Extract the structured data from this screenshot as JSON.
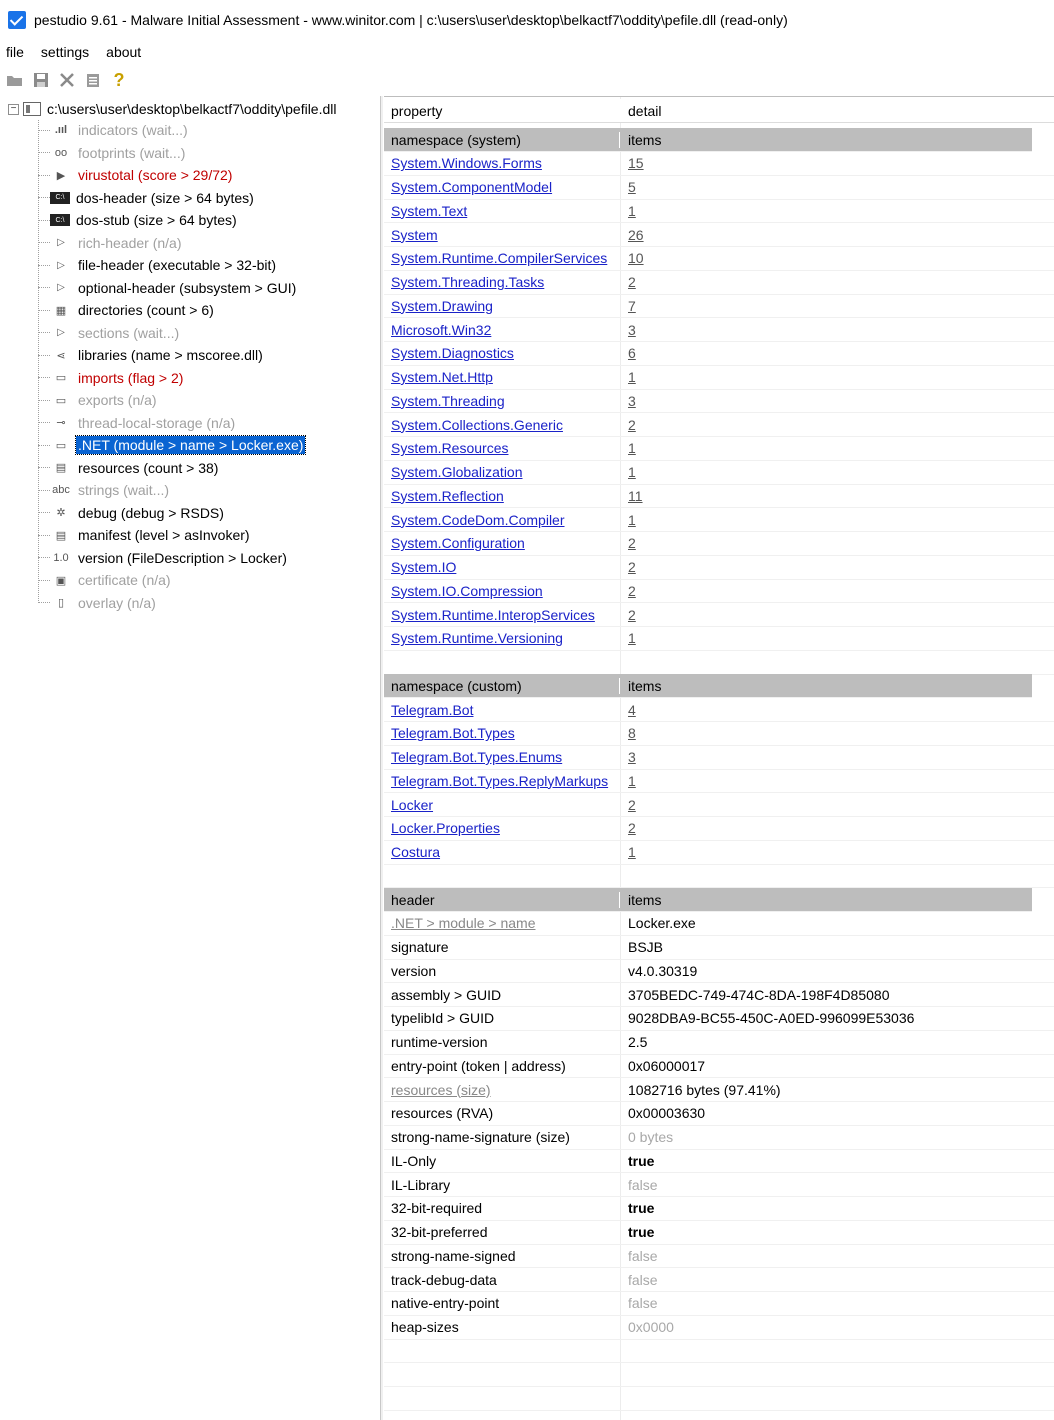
{
  "window": {
    "title": "pestudio 9.61 - Malware Initial Assessment - www.winitor.com | c:\\users\\user\\desktop\\belkactf7\\oddity\\pefile.dll (read-only)"
  },
  "menu": [
    "file",
    "settings",
    "about"
  ],
  "toolbar": {
    "icons": [
      "open-icon",
      "save-icon",
      "close-icon",
      "copy-icon",
      "help-icon"
    ],
    "help_glyph": "?"
  },
  "tree": {
    "root": "c:\\users\\user\\desktop\\belkactf7\\oddity\\pefile.dll",
    "root_expander": "−",
    "nodes": [
      {
        "label": "indicators (wait...)",
        "state": "grey",
        "icon": "indicators-icon",
        "glyph": ".ııl"
      },
      {
        "label": "footprints (wait...)",
        "state": "grey",
        "icon": "footprints-icon",
        "glyph": "oo"
      },
      {
        "label": "virustotal (score > 29/72)",
        "state": "red",
        "icon": "virustotal-icon",
        "glyph": "▶"
      },
      {
        "label": "dos-header (size > 64 bytes)",
        "state": "normal",
        "icon": "dos-header-icon",
        "glyph": "C:\\"
      },
      {
        "label": "dos-stub (size > 64 bytes)",
        "state": "normal",
        "icon": "dos-stub-icon",
        "glyph": "C:\\"
      },
      {
        "label": "rich-header (n/a)",
        "state": "grey",
        "icon": "rich-header-icon",
        "glyph": "▷"
      },
      {
        "label": "file-header (executable > 32-bit)",
        "state": "normal",
        "icon": "file-header-icon",
        "glyph": "▷"
      },
      {
        "label": "optional-header (subsystem > GUI)",
        "state": "normal",
        "icon": "optional-header-icon",
        "glyph": "▷"
      },
      {
        "label": "directories (count > 6)",
        "state": "normal",
        "icon": "directories-icon",
        "glyph": "▦"
      },
      {
        "label": "sections (wait...)",
        "state": "grey",
        "icon": "sections-icon",
        "glyph": "▷"
      },
      {
        "label": "libraries (name > mscoree.dll)",
        "state": "normal",
        "icon": "libraries-icon",
        "glyph": "⋖"
      },
      {
        "label": "imports (flag > 2)",
        "state": "red",
        "icon": "imports-icon",
        "glyph": "▭"
      },
      {
        "label": "exports (n/a)",
        "state": "grey",
        "icon": "exports-icon",
        "glyph": "▭"
      },
      {
        "label": "thread-local-storage (n/a)",
        "state": "grey",
        "icon": "tls-icon",
        "glyph": "⊸"
      },
      {
        "label": ".NET (module > name > Locker.exe)",
        "state": "sel",
        "icon": "dotnet-icon",
        "glyph": "▭"
      },
      {
        "label": "resources (count > 38)",
        "state": "normal",
        "icon": "resources-icon",
        "glyph": "▤"
      },
      {
        "label": "strings (wait...)",
        "state": "grey",
        "icon": "strings-icon",
        "glyph": "abc"
      },
      {
        "label": "debug (debug > RSDS)",
        "state": "normal",
        "icon": "debug-icon",
        "glyph": "✲"
      },
      {
        "label": "manifest (level > asInvoker)",
        "state": "normal",
        "icon": "manifest-icon",
        "glyph": "▤"
      },
      {
        "label": "version (FileDescription > Locker)",
        "state": "normal",
        "icon": "version-icon",
        "glyph": "1.0"
      },
      {
        "label": "certificate (n/a)",
        "state": "grey",
        "icon": "certificate-icon",
        "glyph": "▣"
      },
      {
        "label": "overlay (n/a)",
        "state": "grey",
        "icon": "overlay-icon",
        "glyph": "▯"
      }
    ]
  },
  "table": {
    "columns": [
      "property",
      "detail"
    ],
    "rows": [
      {
        "type": "group",
        "c1": "namespace (system)",
        "c2": "items"
      },
      {
        "type": "link",
        "c1": "System.Windows.Forms",
        "c2": "15"
      },
      {
        "type": "link",
        "c1": "System.ComponentModel",
        "c2": "5"
      },
      {
        "type": "link",
        "c1": "System.Text",
        "c2": "1"
      },
      {
        "type": "link",
        "c1": "System",
        "c2": "26"
      },
      {
        "type": "link",
        "c1": "System.Runtime.CompilerServices",
        "c2": "10"
      },
      {
        "type": "link",
        "c1": "System.Threading.Tasks",
        "c2": "2"
      },
      {
        "type": "link",
        "c1": "System.Drawing",
        "c2": "7"
      },
      {
        "type": "link",
        "c1": "Microsoft.Win32",
        "c2": "3"
      },
      {
        "type": "link",
        "c1": "System.Diagnostics",
        "c2": "6"
      },
      {
        "type": "link",
        "c1": "System.Net.Http",
        "c2": "1"
      },
      {
        "type": "link",
        "c1": "System.Threading",
        "c2": "3"
      },
      {
        "type": "link",
        "c1": "System.Collections.Generic",
        "c2": "2"
      },
      {
        "type": "link",
        "c1": "System.Resources",
        "c2": "1"
      },
      {
        "type": "link",
        "c1": "System.Globalization",
        "c2": "1"
      },
      {
        "type": "link",
        "c1": "System.Reflection",
        "c2": "11"
      },
      {
        "type": "link",
        "c1": "System.CodeDom.Compiler",
        "c2": "1"
      },
      {
        "type": "link",
        "c1": "System.Configuration",
        "c2": "2"
      },
      {
        "type": "link",
        "c1": "System.IO",
        "c2": "2"
      },
      {
        "type": "link",
        "c1": "System.IO.Compression",
        "c2": "2"
      },
      {
        "type": "link",
        "c1": "System.Runtime.InteropServices",
        "c2": "2"
      },
      {
        "type": "link",
        "c1": "System.Runtime.Versioning",
        "c2": "1"
      },
      {
        "type": "blank",
        "c1": "",
        "c2": ""
      },
      {
        "type": "group",
        "c1": "namespace (custom)",
        "c2": "items"
      },
      {
        "type": "link",
        "c1": "Telegram.Bot",
        "c2": "4"
      },
      {
        "type": "link",
        "c1": "Telegram.Bot.Types",
        "c2": "8"
      },
      {
        "type": "link",
        "c1": "Telegram.Bot.Types.Enums",
        "c2": "3"
      },
      {
        "type": "link",
        "c1": "Telegram.Bot.Types.ReplyMarkups",
        "c2": "1"
      },
      {
        "type": "link",
        "c1": "Locker",
        "c2": "2"
      },
      {
        "type": "link",
        "c1": "Locker.Properties",
        "c2": "2"
      },
      {
        "type": "link",
        "c1": "Costura",
        "c2": "1"
      },
      {
        "type": "blank",
        "c1": "",
        "c2": ""
      },
      {
        "type": "group",
        "c1": "header",
        "c2": "items"
      },
      {
        "type": "glink",
        "c1": ".NET > module > name",
        "c2": "Locker.exe",
        "style2": ""
      },
      {
        "type": "kv",
        "c1": "signature",
        "c2": "BSJB",
        "style2": ""
      },
      {
        "type": "kv",
        "c1": "version",
        "c2": "v4.0.30319",
        "style2": ""
      },
      {
        "type": "kv",
        "c1": "assembly > GUID",
        "c2": "3705BEDC-749-474C-8DA-198F4D85080",
        "style2": ""
      },
      {
        "type": "kv",
        "c1": "typelibId > GUID",
        "c2": "9028DBA9-BC55-450C-A0ED-996099E53036",
        "style2": ""
      },
      {
        "type": "kv",
        "c1": "runtime-version",
        "c2": "2.5",
        "style2": ""
      },
      {
        "type": "kv",
        "c1": "entry-point (token | address)",
        "c2": "0x06000017",
        "style2": ""
      },
      {
        "type": "glink",
        "c1": "resources (size)",
        "c2": "1082716 bytes (97.41%)",
        "style2": ""
      },
      {
        "type": "kv",
        "c1": "resources (RVA)",
        "c2": "0x00003630",
        "style2": ""
      },
      {
        "type": "kv",
        "c1": "strong-name-signature (size)",
        "c2": "0 bytes",
        "style2": "muted"
      },
      {
        "type": "kv",
        "c1": "IL-Only",
        "c2": "true",
        "style2": "bold"
      },
      {
        "type": "kv",
        "c1": "IL-Library",
        "c2": "false",
        "style2": "muted"
      },
      {
        "type": "kv",
        "c1": "32-bit-required",
        "c2": "true",
        "style2": "bold"
      },
      {
        "type": "kv",
        "c1": "32-bit-preferred",
        "c2": "true",
        "style2": "bold"
      },
      {
        "type": "kv",
        "c1": "strong-name-signed",
        "c2": "false",
        "style2": "muted"
      },
      {
        "type": "kv",
        "c1": "track-debug-data",
        "c2": "false",
        "style2": "muted"
      },
      {
        "type": "kv",
        "c1": "native-entry-point",
        "c2": "false",
        "style2": "muted"
      },
      {
        "type": "kv",
        "c1": "heap-sizes",
        "c2": "0x0000",
        "style2": "muted"
      },
      {
        "type": "blank",
        "c1": "",
        "c2": ""
      },
      {
        "type": "blank",
        "c1": "",
        "c2": ""
      },
      {
        "type": "blank",
        "c1": "",
        "c2": ""
      }
    ]
  }
}
